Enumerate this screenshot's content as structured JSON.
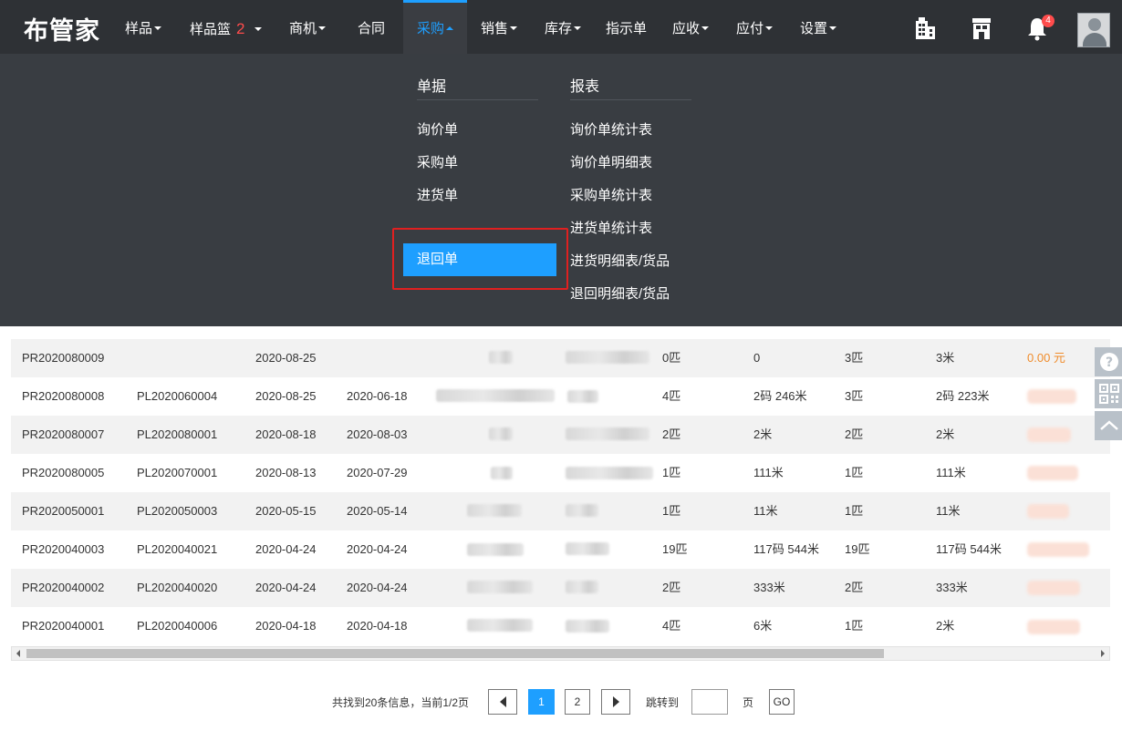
{
  "brand": {
    "logo": "布管家"
  },
  "nav": {
    "items": [
      {
        "label": "样品",
        "caret": true
      },
      {
        "label": "样品篮",
        "badge": "2",
        "caret": true
      },
      {
        "label": "商机",
        "caret": true
      },
      {
        "label": "合同",
        "caret": false
      },
      {
        "label": "采购",
        "caret": true,
        "active": true
      },
      {
        "label": "销售",
        "caret": true
      },
      {
        "label": "库存",
        "caret": true
      },
      {
        "label": "指示单",
        "caret": false
      },
      {
        "label": "应收",
        "caret": true
      },
      {
        "label": "应付",
        "caret": true
      },
      {
        "label": "设置",
        "caret": true
      }
    ],
    "notification_count": "4",
    "icons": [
      "building-icon",
      "store-icon",
      "bell-icon",
      "avatar"
    ]
  },
  "dropdown": {
    "documents": {
      "heading": "单据",
      "items": [
        "询价单",
        "采购单",
        "进货单",
        "退回单"
      ],
      "selected": "退回单"
    },
    "reports": {
      "heading": "报表",
      "items": [
        "询价单统计表",
        "询价单明细表",
        "采购单统计表",
        "进货单统计表",
        "进货明细表/货品",
        "退回明细表/货品"
      ]
    }
  },
  "table": {
    "rows": [
      {
        "no": "PR2020080009",
        "ref": "",
        "date": "2020-08-25",
        "ref_date": "",
        "qty_a": "0匹",
        "len_a": "0",
        "qty_b": "3匹",
        "len_b": "3米",
        "amount": "0.00 元"
      },
      {
        "no": "PR2020080008",
        "ref": "PL2020060004",
        "date": "2020-08-25",
        "ref_date": "2020-06-18",
        "qty_a": "4匹",
        "len_a": "2码 246米",
        "qty_b": "3匹",
        "len_b": "2码 223米",
        "amount": ""
      },
      {
        "no": "PR2020080007",
        "ref": "PL2020080001",
        "date": "2020-08-18",
        "ref_date": "2020-08-03",
        "qty_a": "2匹",
        "len_a": "2米",
        "qty_b": "2匹",
        "len_b": "2米",
        "amount": ""
      },
      {
        "no": "PR2020080005",
        "ref": "PL2020070001",
        "date": "2020-08-13",
        "ref_date": "2020-07-29",
        "qty_a": "1匹",
        "len_a": "111米",
        "qty_b": "1匹",
        "len_b": "111米",
        "amount": ""
      },
      {
        "no": "PR2020050001",
        "ref": "PL2020050003",
        "date": "2020-05-15",
        "ref_date": "2020-05-14",
        "qty_a": "1匹",
        "len_a": "11米",
        "qty_b": "1匹",
        "len_b": "11米",
        "amount": ""
      },
      {
        "no": "PR2020040003",
        "ref": "PL2020040021",
        "date": "2020-04-24",
        "ref_date": "2020-04-24",
        "qty_a": "19匹",
        "len_a": "117码 544米",
        "qty_b": "19匹",
        "len_b": "117码 544米",
        "amount": ""
      },
      {
        "no": "PR2020040002",
        "ref": "PL2020040020",
        "date": "2020-04-24",
        "ref_date": "2020-04-24",
        "qty_a": "2匹",
        "len_a": "333米",
        "qty_b": "2匹",
        "len_b": "333米",
        "amount": ""
      },
      {
        "no": "PR2020040001",
        "ref": "PL2020040006",
        "date": "2020-04-18",
        "ref_date": "2020-04-18",
        "qty_a": "4匹",
        "len_a": "6米",
        "qty_b": "1匹",
        "len_b": "2米",
        "amount": ""
      }
    ]
  },
  "pagination": {
    "summary": "共找到20条信息，当前1/2页",
    "pages": [
      "1",
      "2"
    ],
    "current": "1",
    "jump_label": "跳转到",
    "page_unit": "页",
    "go_label": "GO"
  },
  "colors": {
    "nav_bg": "#2e3135",
    "menu_bg": "#393d42",
    "accent": "#1e9fff",
    "highlight": "#e02020",
    "amount": "#f08c2b"
  }
}
